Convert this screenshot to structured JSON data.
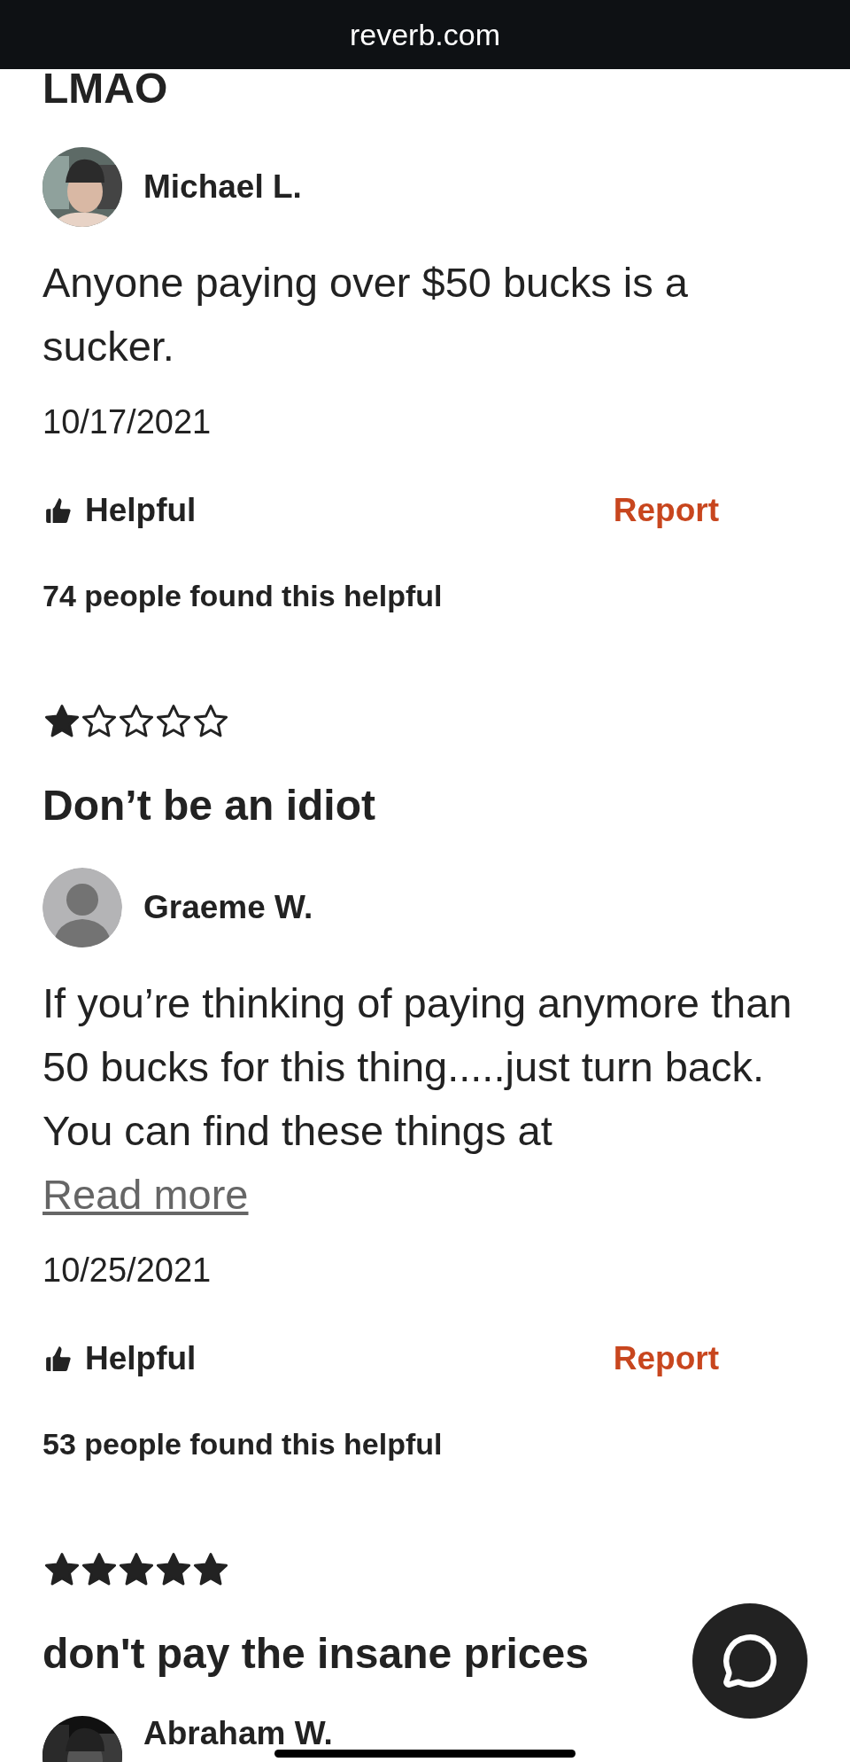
{
  "browser_bar": {
    "url": "reverb.com"
  },
  "reviews": [
    {
      "title": "LMAO",
      "author": "Michael L.",
      "body": "Anyone paying over $50 bucks is a sucker.",
      "date": "10/17/2021",
      "helpful_label": "Helpful",
      "report_label": "Report",
      "helpful_count": "74 people found this helpful"
    },
    {
      "stars": 1,
      "title": "Don’t be an idiot",
      "author": "Graeme W.",
      "avatar": {
        "kind": "default"
      },
      "body": "If you’re thinking of paying anymore than 50 bucks for this thing.....just turn back. You can find these things at",
      "read_more": "Read more",
      "date": "10/25/2021",
      "helpful_label": "Helpful",
      "report_label": "Report",
      "helpful_count": "53 people found this helpful"
    },
    {
      "stars": 5,
      "title": "don't pay the insane prices",
      "author": "Abraham W."
    }
  ]
}
